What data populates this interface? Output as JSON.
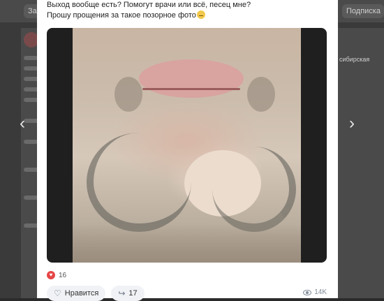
{
  "background": {
    "top_left_chip": "За",
    "top_right_chip": "Подписка",
    "right_fragment": "сибирская"
  },
  "post": {
    "lines": [
      "Выход вообще есть? Помогут врачи или всё, песец мне?",
      "Прошу прощения за такое позорное фото"
    ],
    "emoji_icon": "downcast-face-emoji",
    "photo_alt": "Фото подбородка с бородой"
  },
  "reactions": {
    "icon": "heart-icon",
    "count": "16"
  },
  "actions": {
    "like_label": "Нравится",
    "like_icon": "heart-outline-icon",
    "share_count": "17",
    "share_icon": "share-arrow-icon"
  },
  "views": {
    "icon": "eye-icon",
    "count": "14K"
  },
  "nav": {
    "prev_icon": "chevron-left-icon",
    "next_icon": "chevron-right-icon"
  },
  "colors": {
    "accent_heart": "#e64646",
    "card_bg": "#ffffff",
    "backdrop": "#2b2b2b"
  }
}
